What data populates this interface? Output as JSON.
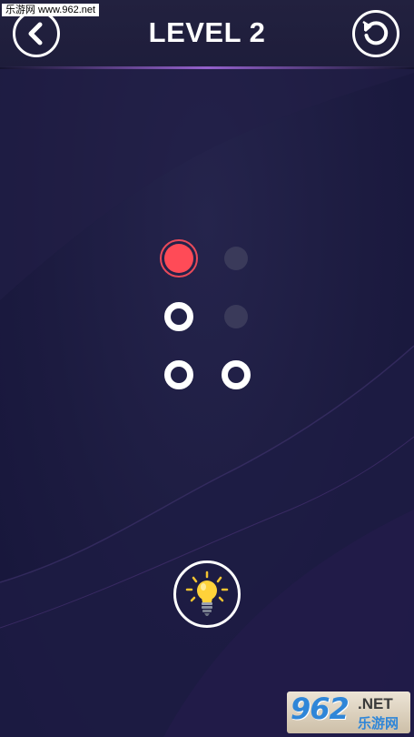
{
  "watermark_top": "乐游网 www.962.net",
  "header": {
    "title": "LEVEL 2",
    "back_icon": "chevron-left-icon",
    "restart_icon": "restart-icon"
  },
  "board": {
    "colors": {
      "active": "#ff4b57",
      "empty_ring": "#ffffff",
      "blocked": "#3a3a5a"
    },
    "nodes": [
      {
        "row": 1,
        "col": 1,
        "state": "active"
      },
      {
        "row": 1,
        "col": 2,
        "state": "blocked"
      },
      {
        "row": 2,
        "col": 1,
        "state": "empty"
      },
      {
        "row": 2,
        "col": 2,
        "state": "blocked"
      },
      {
        "row": 3,
        "col": 1,
        "state": "empty"
      },
      {
        "row": 3,
        "col": 2,
        "state": "empty"
      }
    ]
  },
  "hint": {
    "icon": "lightbulb-icon"
  },
  "watermark_logo": {
    "number": "962",
    "suffix": ".NET",
    "cn": "乐游网"
  }
}
